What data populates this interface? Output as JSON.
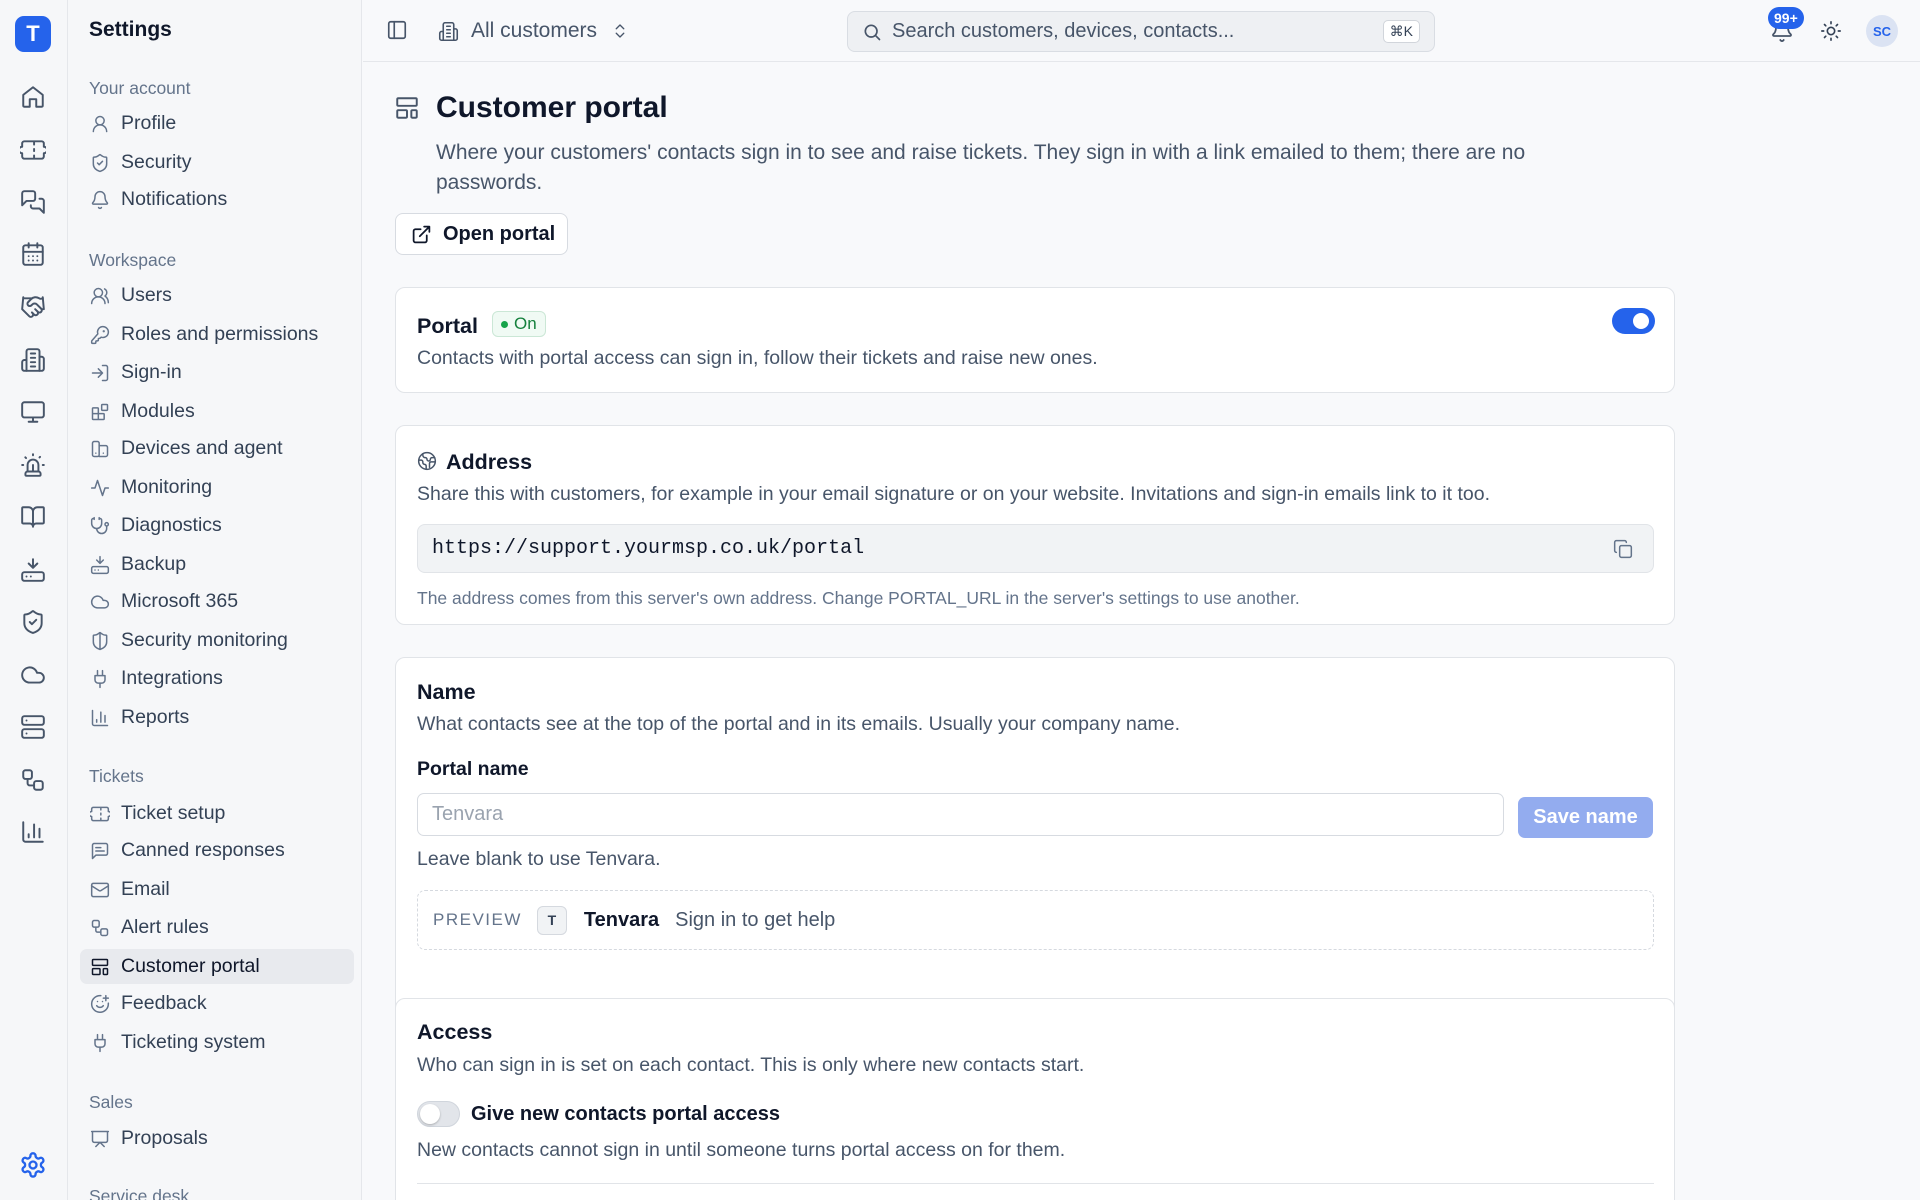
{
  "rail": {
    "logo_letter": "T",
    "icons": [
      "home-icon",
      "ticket-icon",
      "messages-icon",
      "calendar-icon",
      "handshake-icon",
      "building-icon",
      "monitor-icon",
      "siren-icon",
      "book-icon",
      "download-icon",
      "shield-icon",
      "cloud-icon",
      "server-icon",
      "workflow-icon",
      "bar-chart-icon"
    ],
    "settings_icon": "gear-icon"
  },
  "settings_nav": {
    "title": "Settings",
    "sections": [
      {
        "label": "Your account",
        "items": [
          {
            "label": "Profile",
            "icon": "user-icon"
          },
          {
            "label": "Security",
            "icon": "shield-check-icon"
          },
          {
            "label": "Notifications",
            "icon": "bell-icon"
          }
        ]
      },
      {
        "label": "Workspace",
        "items": [
          {
            "label": "Users",
            "icon": "users-icon"
          },
          {
            "label": "Roles and permissions",
            "icon": "key-icon"
          },
          {
            "label": "Sign-in",
            "icon": "log-in-icon"
          },
          {
            "label": "Modules",
            "icon": "blocks-icon"
          },
          {
            "label": "Devices and agent",
            "icon": "devices-icon"
          },
          {
            "label": "Monitoring",
            "icon": "activity-icon"
          },
          {
            "label": "Diagnostics",
            "icon": "stethoscope-icon"
          },
          {
            "label": "Backup",
            "icon": "hard-drive-download-icon"
          },
          {
            "label": "Microsoft 365",
            "icon": "cloud-icon"
          },
          {
            "label": "Security monitoring",
            "icon": "shield-half-icon"
          },
          {
            "label": "Integrations",
            "icon": "plug-icon"
          },
          {
            "label": "Reports",
            "icon": "bar-chart-icon"
          }
        ]
      },
      {
        "label": "Tickets",
        "items": [
          {
            "label": "Ticket setup",
            "icon": "ticket-icon"
          },
          {
            "label": "Canned responses",
            "icon": "message-square-text-icon"
          },
          {
            "label": "Email",
            "icon": "mail-icon"
          },
          {
            "label": "Alert rules",
            "icon": "workflow-icon"
          },
          {
            "label": "Customer portal",
            "icon": "layout-template-icon",
            "active": true
          },
          {
            "label": "Feedback",
            "icon": "smile-icon"
          },
          {
            "label": "Ticketing system",
            "icon": "plug-icon"
          }
        ]
      },
      {
        "label": "Sales",
        "items": [
          {
            "label": "Proposals",
            "icon": "presentation-icon"
          }
        ]
      },
      {
        "label": "Service desk",
        "items": []
      }
    ]
  },
  "topbar": {
    "customer_selector": "All customers",
    "search_placeholder": "Search customers, devices, contacts...",
    "search_shortcut": "⌘K",
    "notification_count": "99+",
    "avatar_initials": "SC"
  },
  "page": {
    "title": "Customer portal",
    "description": "Where your customers' contacts sign in to see and raise tickets. They sign in with a link emailed to them; there are no passwords.",
    "open_portal_label": "Open portal"
  },
  "portal_card": {
    "title": "Portal",
    "status": "On",
    "enabled": true,
    "description": "Contacts with portal access can sign in, follow their tickets and raise new ones."
  },
  "address_card": {
    "title": "Address",
    "description": "Share this with customers, for example in your email signature or on your website. Invitations and sign-in emails link to it too.",
    "url": "https://support.yourmsp.co.uk/portal",
    "note": "The address comes from this server's own address. Change PORTAL_URL in the server's settings to use another."
  },
  "name_card": {
    "title": "Name",
    "description": "What contacts see at the top of the portal and in its emails. Usually your company name.",
    "field_label": "Portal name",
    "placeholder": "Tenvara",
    "value": "",
    "save_label": "Save name",
    "hint": "Leave blank to use Tenvara.",
    "preview_label": "PREVIEW",
    "preview_logo": "T",
    "preview_name": "Tenvara",
    "preview_subtitle": "Sign in to get help"
  },
  "access_card": {
    "title": "Access",
    "description": "Who can sign in is set on each contact. This is only where new contacts start.",
    "toggle_label": "Give new contacts portal access",
    "toggle_on": false,
    "toggle_help": "New contacts cannot sign in until someone turns portal access on for them."
  },
  "colors": {
    "accent": "#2563eb",
    "status_on": "#16a34a",
    "save_disabled": "#93acef"
  }
}
